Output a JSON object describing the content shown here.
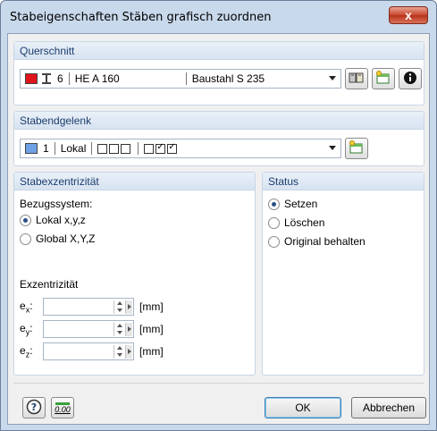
{
  "window": {
    "title": "Stabeigenschaften Stäben grafisch zuordnen",
    "close_glyph": "x"
  },
  "querschnitt": {
    "header": "Querschnitt",
    "color": "#e0141b",
    "number": "6",
    "profile": "HE A 160",
    "material": "Baustahl S 235"
  },
  "stabendgelenk": {
    "header": "Stabendgelenk",
    "color": "#6fa1e6",
    "number": "1",
    "system": "Lokal"
  },
  "stabexzentrizitaet": {
    "header": "Stabexzentrizität",
    "bezug_label": "Bezugssystem:",
    "options": [
      {
        "label": "Lokal x,y,z",
        "selected": true
      },
      {
        "label": "Global X,Y,Z",
        "selected": false
      }
    ],
    "exzentrizitaet_label": "Exzentrizität",
    "fields": [
      {
        "label_main": "e",
        "label_sub": "x",
        "value": "",
        "unit": "[mm]"
      },
      {
        "label_main": "e",
        "label_sub": "y",
        "value": "",
        "unit": "[mm]"
      },
      {
        "label_main": "e",
        "label_sub": "z",
        "value": "",
        "unit": "[mm]"
      }
    ]
  },
  "status": {
    "header": "Status",
    "options": [
      {
        "label": "Setzen",
        "selected": true
      },
      {
        "label": "Löschen",
        "selected": false
      },
      {
        "label": "Original behalten",
        "selected": false
      }
    ]
  },
  "footer": {
    "ok_label": "OK",
    "cancel_label": "Abbrechen",
    "units_label": "0.00"
  }
}
